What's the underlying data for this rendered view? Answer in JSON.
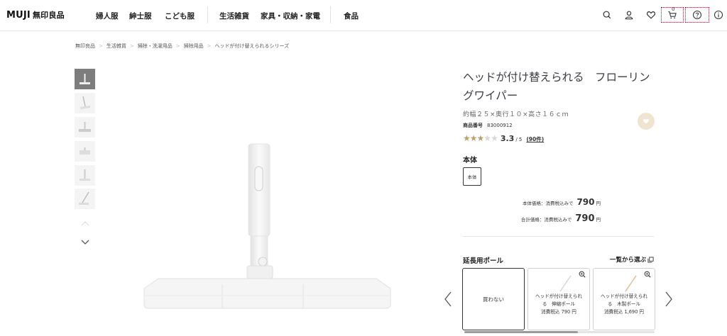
{
  "header": {
    "logo_en": "MUJI",
    "logo_jp": "無印良品",
    "nav": [
      "婦人服",
      "紳士服",
      "こども服",
      "生活雑貨",
      "家具・収納・家電",
      "食品"
    ],
    "cart_count": "0"
  },
  "breadcrumb": [
    "無印良品",
    "生活雑貨",
    "掃除・洗濯用品",
    "掃除用品",
    "ヘッドが付け替えられるシリーズ"
  ],
  "product": {
    "title": "ヘッドが付け替えられる　フローリングワイパー",
    "size": "約幅２５×奥行１０×高さ１６ｃｍ",
    "code_label": "商品番号",
    "code": "83000912",
    "rating": 3.3,
    "rating_text": "3.3",
    "rating_max": "/ 5",
    "reviews": "(90件)",
    "variant_heading": "本体",
    "variant_option": "本体",
    "price_label": "本体価格：消費税込みで",
    "price": "790",
    "total_label": "合計価格：消費税込みで",
    "total": "790",
    "yen": "円"
  },
  "extension": {
    "heading": "延長用ポール",
    "link": "一覧から選ぶ",
    "cards": [
      {
        "label": "買わない"
      },
      {
        "name1": "ヘッドが付け替えられ",
        "name2": "る　伸縮ポール",
        "price": "消費税込 790 円"
      },
      {
        "name1": "ヘッドが付け替えられ",
        "name2": "る　木製ポール",
        "price": "消費税込 1,690 円"
      }
    ]
  },
  "colors": {
    "star": "#b9a26c",
    "accent_outline": "#c8102e",
    "fav_bg": "#efe4cf"
  }
}
